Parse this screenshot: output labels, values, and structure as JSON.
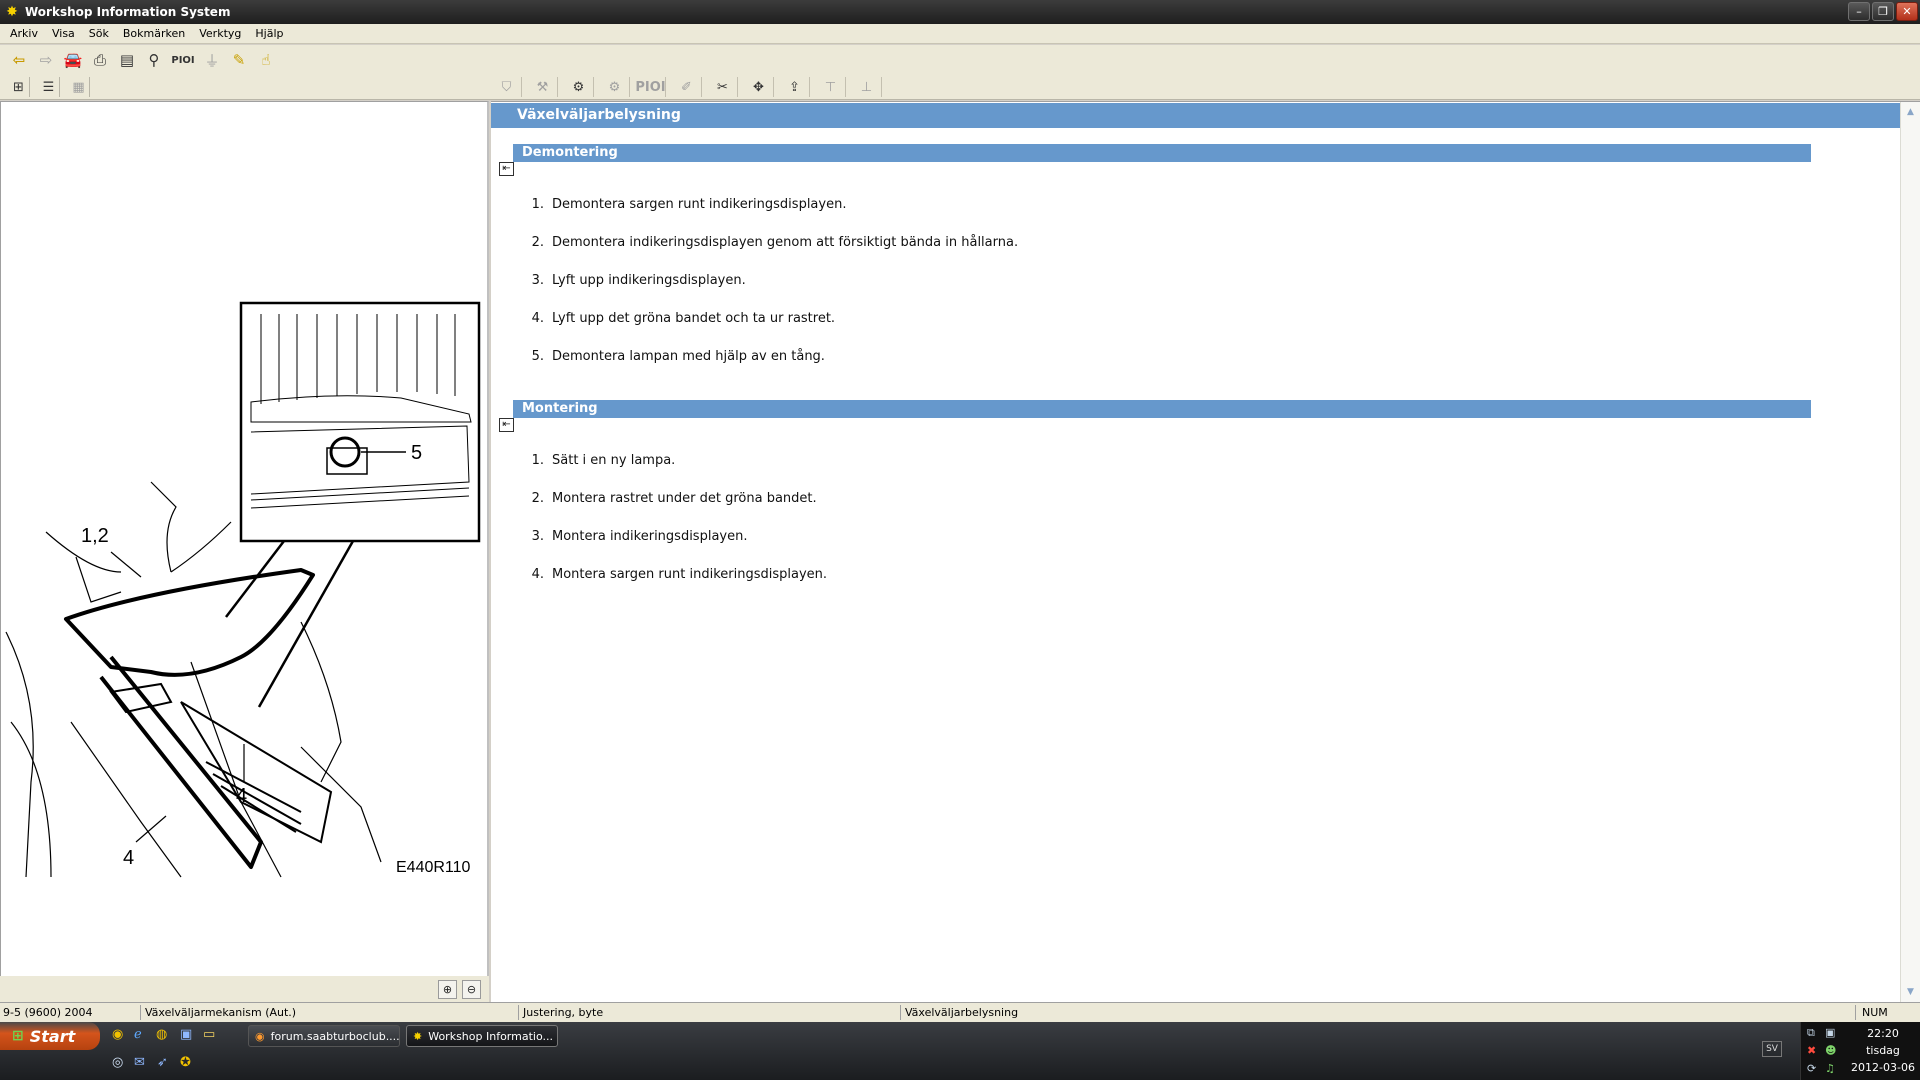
{
  "window": {
    "title": "Workshop Information System",
    "minimize": "–",
    "restore": "❐",
    "close": "✕"
  },
  "menu": [
    "Arkiv",
    "Visa",
    "Sök",
    "Bokmärken",
    "Verktyg",
    "Hjälp"
  ],
  "toolbar": {
    "pioi_label": "PIOI",
    "pioi_label_dim": "PIOI"
  },
  "figure": {
    "callout_1_2": "1,2",
    "callout_4a": "4",
    "callout_4b": "4",
    "callout_5": "5",
    "figure_id": "E440R110"
  },
  "document": {
    "title": "Växelväljarbelysning",
    "sections": [
      {
        "heading": "Demontering",
        "steps": [
          "Demontera sargen runt indikeringsdisplayen.",
          "Demontera indikeringsdisplayen genom att försiktigt bända in hållarna.",
          "Lyft upp indikeringsdisplayen.",
          "Lyft upp det gröna bandet och ta ur rastret.",
          "Demontera lampan med hjälp av en tång."
        ]
      },
      {
        "heading": "Montering",
        "steps": [
          "Sätt i en ny lampa.",
          "Montera rastret under det gröna bandet.",
          "Montera indikeringsdisplayen.",
          "Montera sargen runt indikeringsdisplayen."
        ]
      }
    ],
    "step_numbers": [
      "1.",
      "2.",
      "3.",
      "4.",
      "5."
    ]
  },
  "statusbar": {
    "model": "9-5 (9600) 2004",
    "component": "Växelväljarmekanism (Aut.)",
    "operation": "Justering, byte",
    "topic": "Växelväljarbelysning",
    "num": "NUM"
  },
  "taskbar": {
    "start": "Start",
    "tasks": [
      "forum.saabturboclub....",
      "Workshop Informatio..."
    ],
    "lang": "SV",
    "time": "22:20",
    "day": "tisdag",
    "date": "2012-03-06"
  },
  "colors": {
    "header_blue": "#6698cc",
    "title_bar": "#1e1e1e"
  }
}
